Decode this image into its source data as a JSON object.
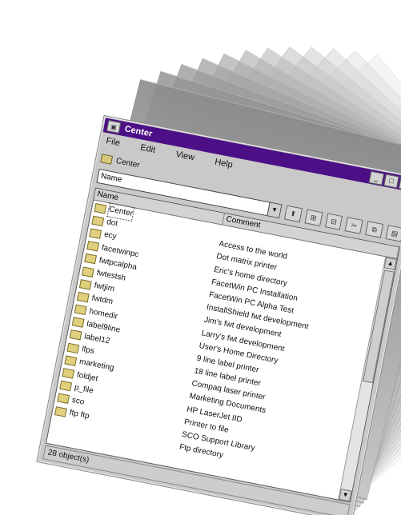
{
  "window": {
    "title": "Center",
    "buttons": {
      "minimize": "_",
      "maximize": "□",
      "close": "×"
    }
  },
  "menu": [
    "File",
    "Edit",
    "View",
    "Help"
  ],
  "address": {
    "label": "Center"
  },
  "toolbar": {
    "dropdown_value": "Name"
  },
  "list": {
    "columns": {
      "name": "Name",
      "comment": "Comment"
    },
    "rows": [
      {
        "name": "Center",
        "comment": ""
      },
      {
        "name": "dot",
        "comment": "Access to the world"
      },
      {
        "name": "ecy",
        "comment": "Dot matrix printer"
      },
      {
        "name": "facetwinpc",
        "comment": "Eric's home directory"
      },
      {
        "name": "fwtpcalpha",
        "comment": "FacetWin PC Installation"
      },
      {
        "name": "fwtestsh",
        "comment": "FacetWin PC Alpha Test"
      },
      {
        "name": "fwtjim",
        "comment": "InstallShield fwt development"
      },
      {
        "name": "fwtdm",
        "comment": "Jim's fwt development"
      },
      {
        "name": "homedir",
        "comment": "Larry's fwt development"
      },
      {
        "name": "label9line",
        "comment": "User's Home Directory"
      },
      {
        "name": "label12",
        "comment": "9 line label printer"
      },
      {
        "name": "lfps",
        "comment": "18 line label printer"
      },
      {
        "name": "marketing",
        "comment": "Compaq laser printer"
      },
      {
        "name": "foldjet",
        "comment": "Marketing Documents"
      },
      {
        "name": "p_file",
        "comment": "HP LaserJet IID"
      },
      {
        "name": "sco",
        "comment": "Printer to file"
      },
      {
        "name": "ftp ftp",
        "comment": "SCO Support Library"
      },
      {
        "name": "",
        "comment": "Ftp directory"
      }
    ]
  },
  "status": {
    "text": "28 object(s)"
  },
  "colors": {
    "titlebar": "#4c0f86",
    "window": "#c9c9c9"
  }
}
